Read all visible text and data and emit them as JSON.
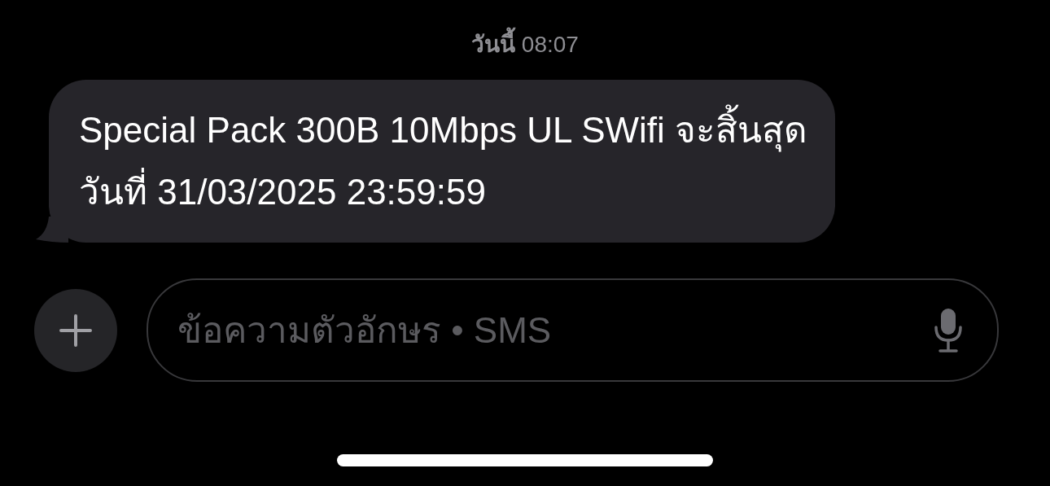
{
  "timestamp": "**วันนี้** 08:07",
  "messages": [
    {
      "text": "Special Pack 300B 10Mbps UL SWifi จะสิ้นสุดวันที่ 31/03/2025 23:59:59"
    }
  ],
  "composer": {
    "placeholder": "ข้อความตัวอักษร • SMS"
  }
}
